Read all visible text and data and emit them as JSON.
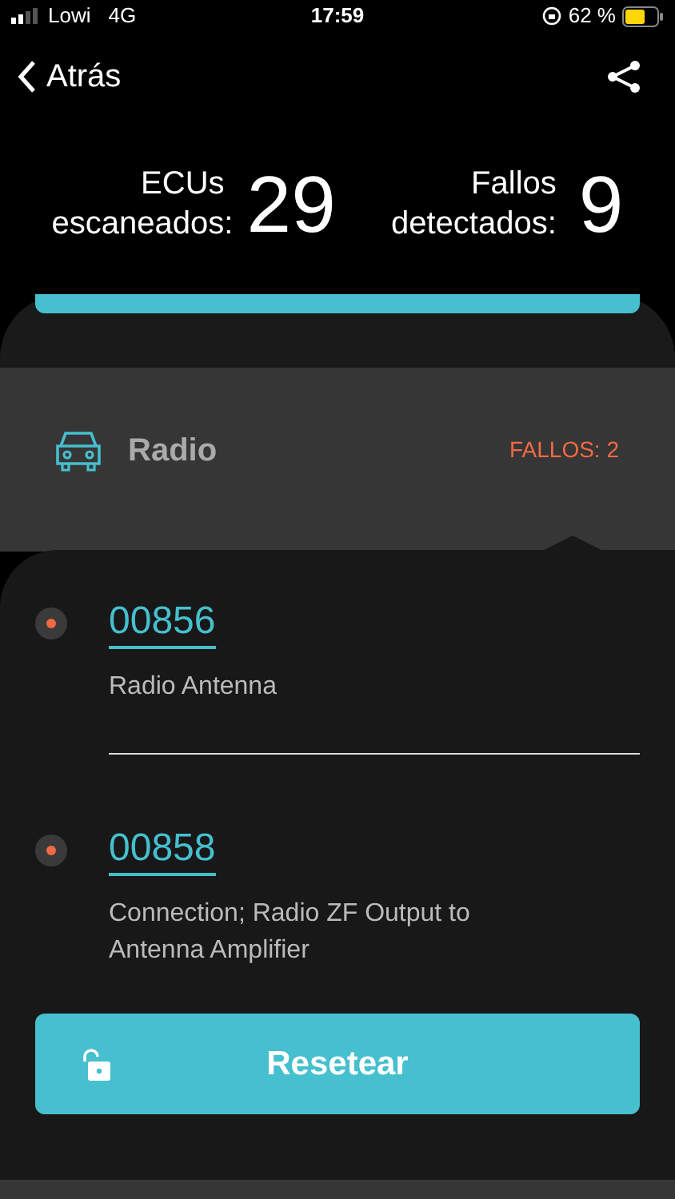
{
  "status_bar": {
    "carrier": "Lowi",
    "network": "4G",
    "time": "17:59",
    "battery": "62 %"
  },
  "nav": {
    "back": "Atrás"
  },
  "stats": [
    {
      "label": "ECUs escaneados:",
      "value": "29"
    },
    {
      "label": "Fallos detectados:",
      "value": "9"
    }
  ],
  "module": {
    "name": "Radio",
    "faults": "FALLOS: 2"
  },
  "faults": [
    {
      "code": "00856",
      "description": "Radio Antenna"
    },
    {
      "code": "00858",
      "description": "Connection; Radio ZF Output to Antenna Amplifier"
    }
  ],
  "reset_button": "Resetear"
}
